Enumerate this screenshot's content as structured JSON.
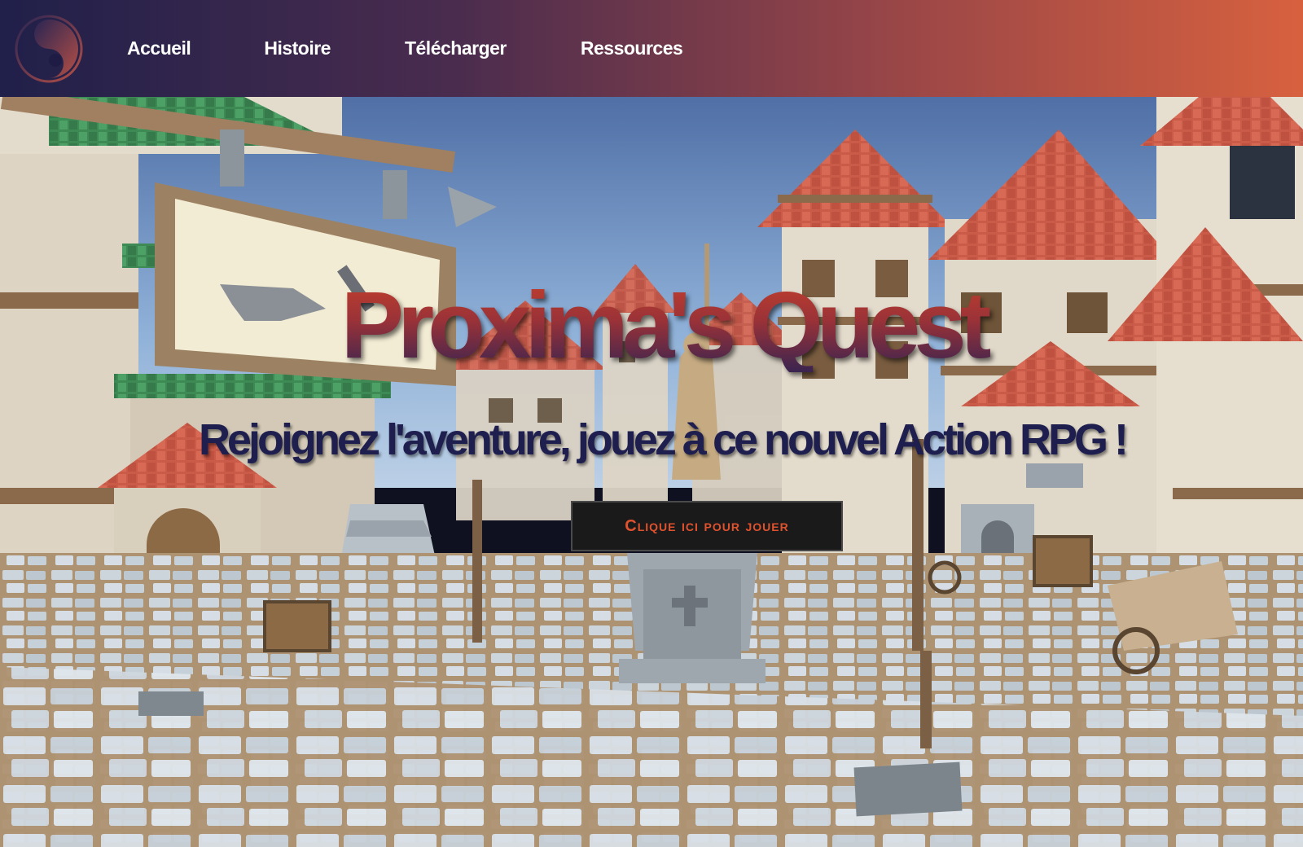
{
  "nav": {
    "logo_icon": "proxima-swirl-logo-icon",
    "links": [
      {
        "label": "Accueil"
      },
      {
        "label": "Histoire"
      },
      {
        "label": "Télécharger"
      },
      {
        "label": "Ressources"
      }
    ]
  },
  "hero": {
    "title": "Proxima's Quest",
    "subtitle": "Rejoignez l'aventure, jouez à ce nouvel Action RPG !",
    "cta_label": "Clique ici pour jouer",
    "background": "medieval-village-3d-scene"
  },
  "colors": {
    "nav_gradient_start": "#20204a",
    "nav_gradient_end": "#d7613f",
    "title_top": "#c23f2c",
    "title_bottom": "#3a2450",
    "subtitle": "#1e1f4f",
    "cta_text": "#e0522e",
    "cta_bg": "#1a1a1a"
  }
}
